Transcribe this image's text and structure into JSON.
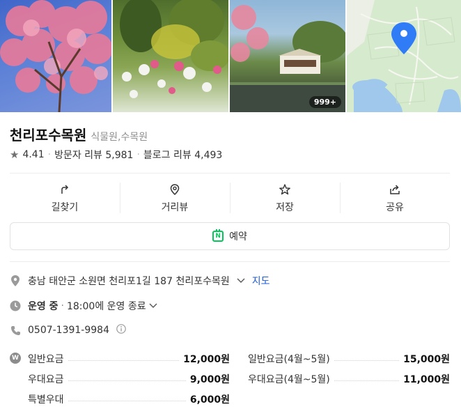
{
  "gallery": {
    "photo_count_badge": "999+",
    "images": [
      "pink-blossom-tree-photo",
      "garden-flowers-photo",
      "pavilion-pond-photo"
    ]
  },
  "place": {
    "name": "천리포수목원",
    "category": "식물원,수목원"
  },
  "stats": {
    "rating": "4.41",
    "visitor_reviews": "방문자 리뷰 5,981",
    "blog_reviews": "블로그 리뷰 4,493"
  },
  "actions": [
    {
      "label": "길찾기",
      "icon": "directions-icon"
    },
    {
      "label": "거리뷰",
      "icon": "location-pin-icon"
    },
    {
      "label": "저장",
      "icon": "star-icon"
    },
    {
      "label": "공유",
      "icon": "share-icon"
    }
  ],
  "reserve": {
    "label": "예약",
    "badge": "N"
  },
  "info": {
    "address": "충남 태안군 소원면 천리포1길 187 천리포수목원",
    "map_link": "지도",
    "status": "운영 중",
    "hours": "18:00에 운영 종료",
    "phone": "0507-1391-9984",
    "won_symbol": "W"
  },
  "fees": {
    "rows": [
      [
        {
          "label": "일반요금",
          "value": "12,000원"
        },
        {
          "label": "일반요금(4월~5월)",
          "value": "15,000원"
        }
      ],
      [
        {
          "label": "우대요금",
          "value": "9,000원"
        },
        {
          "label": "우대요금(4월~5월)",
          "value": "11,000원"
        }
      ],
      [
        {
          "label": "특별우대",
          "value": "6,000원"
        }
      ]
    ]
  },
  "colors": {
    "accent_green": "#03c75a",
    "link_blue": "#1d5bd6",
    "map_pin": "#2f7cf6"
  }
}
